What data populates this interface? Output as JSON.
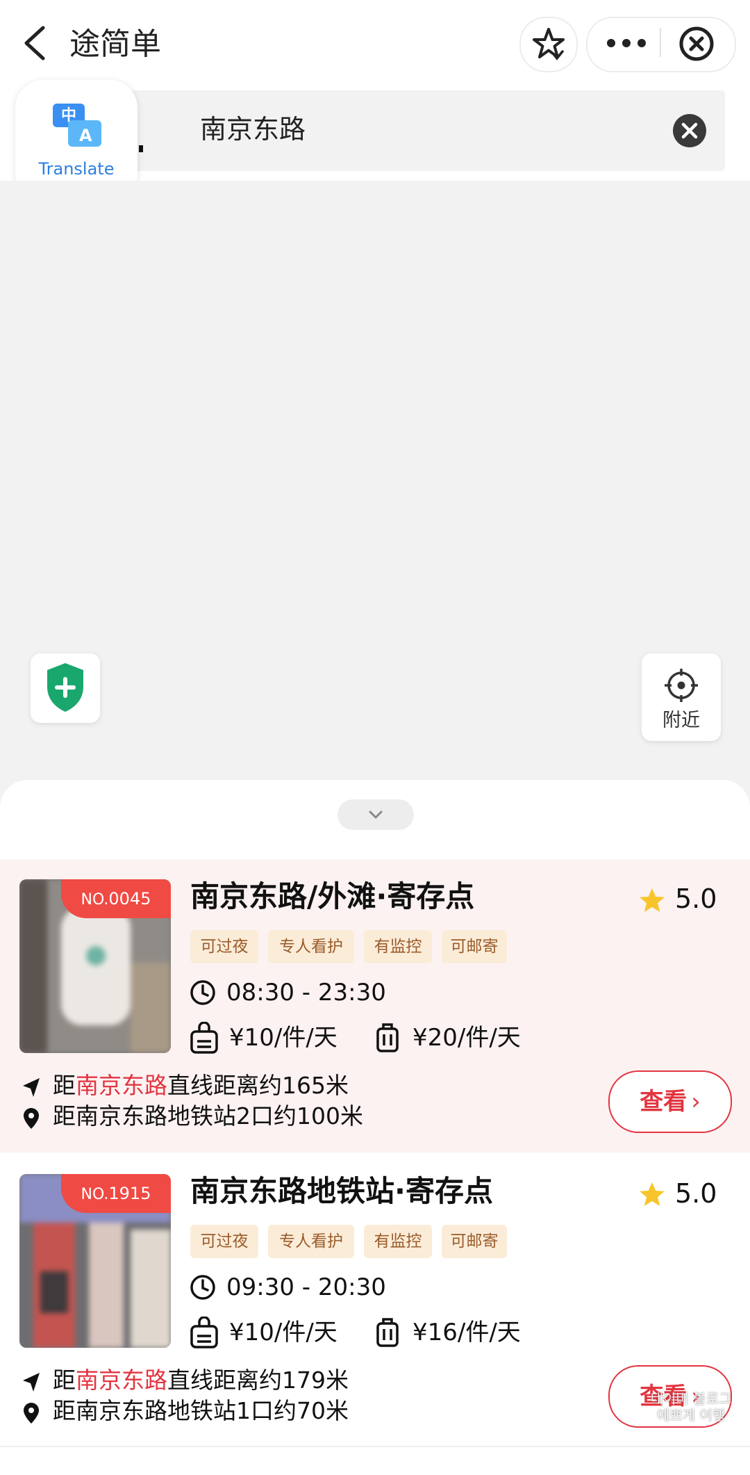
{
  "header": {
    "app_title": "途简单",
    "icons": [
      "back-arrow-icon",
      "star-outline-icon",
      "more-dots-icon",
      "close-circle-icon"
    ]
  },
  "search": {
    "query": "南京东路",
    "icons": [
      "clear-icon"
    ]
  },
  "translate_bubble": {
    "label": "Translate",
    "icon": "translate-zh-a-icon",
    "icon_text_top": "中",
    "icon_text_bottom": "A"
  },
  "map": {
    "safety_icon": "shield-plus-icon",
    "nearby_label": "附近",
    "nearby_icon": "locate-crosshair-icon"
  },
  "colors": {
    "accent": "#e23540",
    "badge": "#f04a44",
    "tag_bg": "#fbecd8",
    "tag_text": "#9a5b2a",
    "card_highlight_bg": "#fdf2f2",
    "shield_green": "#1aa76e",
    "star_yellow": "#f7c52b"
  },
  "results": [
    {
      "badge_prefix": "NO.",
      "badge_number": "0045",
      "name": "南京东路/外滩·寄存点",
      "rating": "5.0",
      "tags": [
        "可过夜",
        "专人看护",
        "有监控",
        "可邮寄"
      ],
      "hours": "08:30 - 23:30",
      "price_small": "¥10/件/天",
      "price_large": "¥20/件/天",
      "dist_prefix": "距",
      "dist_keyword": "南京东路",
      "dist_suffix": "直线距离约165米",
      "metro_text": "距南京东路地铁站2口约100米",
      "view_label": "查看",
      "view_chevron": "›",
      "thumb_palette": [
        "#9a9690",
        "#e8e6e2",
        "#6b6460"
      ]
    },
    {
      "badge_prefix": "NO.",
      "badge_number": "1915",
      "name": "南京东路地铁站·寄存点",
      "rating": "5.0",
      "tags": [
        "可过夜",
        "专人看护",
        "有监控",
        "可邮寄"
      ],
      "hours": "09:30 - 20:30",
      "price_small": "¥10/件/天",
      "price_large": "¥16/件/天",
      "dist_prefix": "距",
      "dist_keyword": "南京东路",
      "dist_suffix": "直线距离约179米",
      "metro_text": "距南京东路地铁站1口约70米",
      "view_label": "查看",
      "view_chevron": "›",
      "thumb_palette": [
        "#c9a4a0",
        "#6e6c70",
        "#d0c9c0"
      ]
    }
  ],
  "watermark": {
    "line1": "네이버 블로그",
    "line2": "예쁘게 여행"
  }
}
